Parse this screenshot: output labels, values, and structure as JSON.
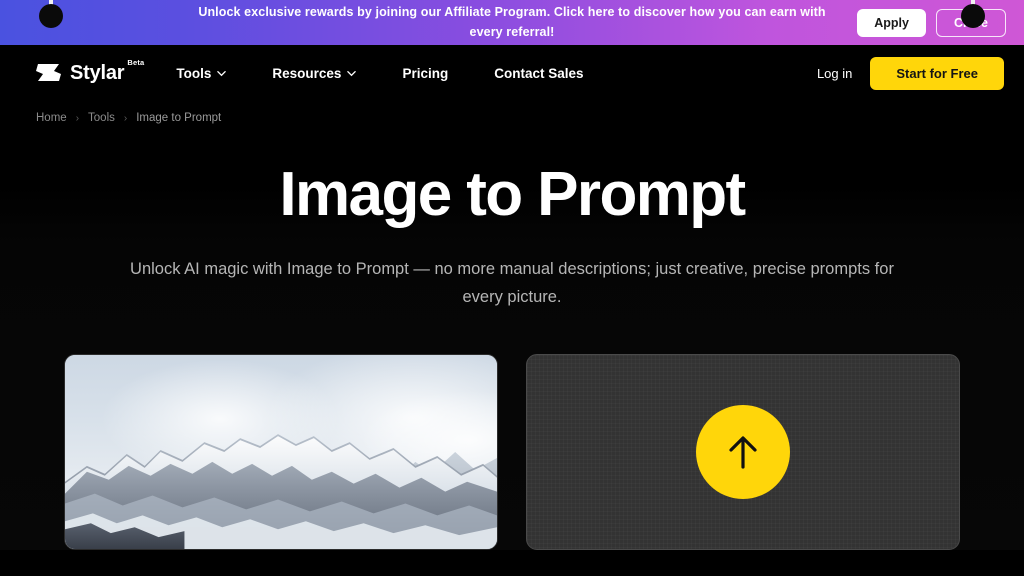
{
  "promo": {
    "message": "Unlock exclusive rewards by joining our Affiliate Program. Click here to discover how you can earn with every referral!",
    "apply_label": "Apply",
    "close_label": "Close",
    "gradient_from": "#4a52e0",
    "gradient_to": "#cf57d6"
  },
  "nav": {
    "brand": "Stylar",
    "beta_label": "Beta",
    "links": [
      {
        "label": "Tools",
        "has_dropdown": true
      },
      {
        "label": "Resources",
        "has_dropdown": true
      },
      {
        "label": "Pricing",
        "has_dropdown": false
      },
      {
        "label": "Contact Sales",
        "has_dropdown": false
      }
    ],
    "login_label": "Log in",
    "cta_label": "Start for Free",
    "cta_color": "#FFD60A"
  },
  "breadcrumb": {
    "items": [
      "Home",
      "Tools",
      "Image to Prompt"
    ],
    "separator": "›"
  },
  "hero": {
    "title": "Image to Prompt",
    "subtitle": "Unlock AI magic with Image to Prompt — no more manual descriptions; just creative, precise prompts for every picture."
  },
  "panels": {
    "photo": {
      "alt": "Snow covered mountain range under a pale blue sky",
      "icon": "mountain-photo"
    },
    "upload": {
      "icon": "upload-arrow-icon",
      "button_color": "#FFD60A"
    }
  }
}
